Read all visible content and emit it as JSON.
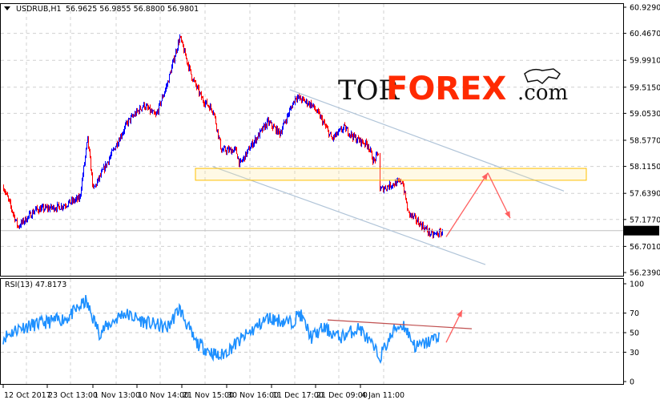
{
  "header": {
    "symbol": "USDRUB,H1",
    "ohlc": "56.9625 56.9855 56.8800 56.9801"
  },
  "logo": {
    "text1": "TOR",
    "text2": "FOREX",
    ".com": ".com",
    "brand_color": "#ff2a00"
  },
  "colors": {
    "bull": "#0000ff",
    "bear": "#ff0000",
    "rsi": "#1e90ff",
    "channel": "#b0c4d8",
    "zone": "#ffc000",
    "arrow": "#ff6060",
    "rsi_trend": "#c05050"
  },
  "chart_data": [
    {
      "type": "candlestick",
      "symbol": "USDRUB",
      "timeframe": "H1",
      "y_ticks": [
        "60.9290",
        "60.4670",
        "59.9910",
        "59.5150",
        "59.0530",
        "58.5770",
        "58.1150",
        "57.6390",
        "57.1770",
        "56.7010",
        "56.2390"
      ],
      "ylim": [
        56.239,
        60.929
      ],
      "x_ticks": [
        "12 Oct 2017",
        "23 Oct 13:00",
        "1 Nov 13:00",
        "10 Nov 14:00",
        "21 Nov 15:00",
        "30 Nov 16:00",
        "11 Dec 17:00",
        "21 Dec 09:00",
        "4 Jan 11:00"
      ],
      "last_price": "56.9801",
      "path_bars": [
        0,
        18,
        40,
        70,
        95,
        105,
        112,
        130,
        155,
        175,
        190,
        205,
        220,
        235,
        248,
        262,
        272,
        290,
        295,
        310,
        330,
        345,
        365,
        385,
        395,
        410,
        425,
        440,
        455,
        462,
        468,
        470,
        485,
        498,
        505,
        520,
        535,
        548
      ],
      "path_prices": [
        57.75,
        57.05,
        57.35,
        57.4,
        57.55,
        58.6,
        57.7,
        58.2,
        58.9,
        59.2,
        59.0,
        59.6,
        60.4,
        59.7,
        59.3,
        59.1,
        58.4,
        58.4,
        58.15,
        58.5,
        58.9,
        58.7,
        59.35,
        59.2,
        59.0,
        58.6,
        58.8,
        58.6,
        58.5,
        58.2,
        58.35,
        57.7,
        57.8,
        57.85,
        57.3,
        57.1,
        56.9,
        56.95
      ],
      "channel_upper": [
        [
          358,
          59.47
        ],
        [
          700,
          57.68
        ]
      ],
      "channel_lower": [
        [
          262,
          58.11
        ],
        [
          602,
          56.38
        ]
      ],
      "support_zone": [
        57.87,
        58.08
      ],
      "forecast_arrows": [
        [
          553,
          56.87
        ],
        [
          605,
          58.0
        ],
        [
          633,
          57.2
        ]
      ]
    },
    {
      "type": "line",
      "title": "RSI(13) 47.8173",
      "y_ticks": [
        "100",
        "70",
        "50",
        "30",
        "0"
      ],
      "ylim": [
        0,
        100
      ],
      "path_bars": [
        0,
        20,
        50,
        80,
        103,
        120,
        150,
        180,
        205,
        220,
        240,
        270,
        300,
        330,
        360,
        370,
        385,
        400,
        420,
        445,
        470,
        490,
        500,
        515,
        530,
        545
      ],
      "path_values": [
        45,
        55,
        60,
        65,
        82,
        50,
        70,
        60,
        55,
        75,
        40,
        25,
        45,
        65,
        60,
        70,
        45,
        55,
        45,
        55,
        25,
        55,
        58,
        35,
        40,
        47.8
      ],
      "trendline": [
        [
          405,
          63
        ],
        [
          585,
          54
        ]
      ],
      "forecast_arrow": [
        [
          553,
          40
        ],
        [
          573,
          73
        ]
      ]
    }
  ]
}
